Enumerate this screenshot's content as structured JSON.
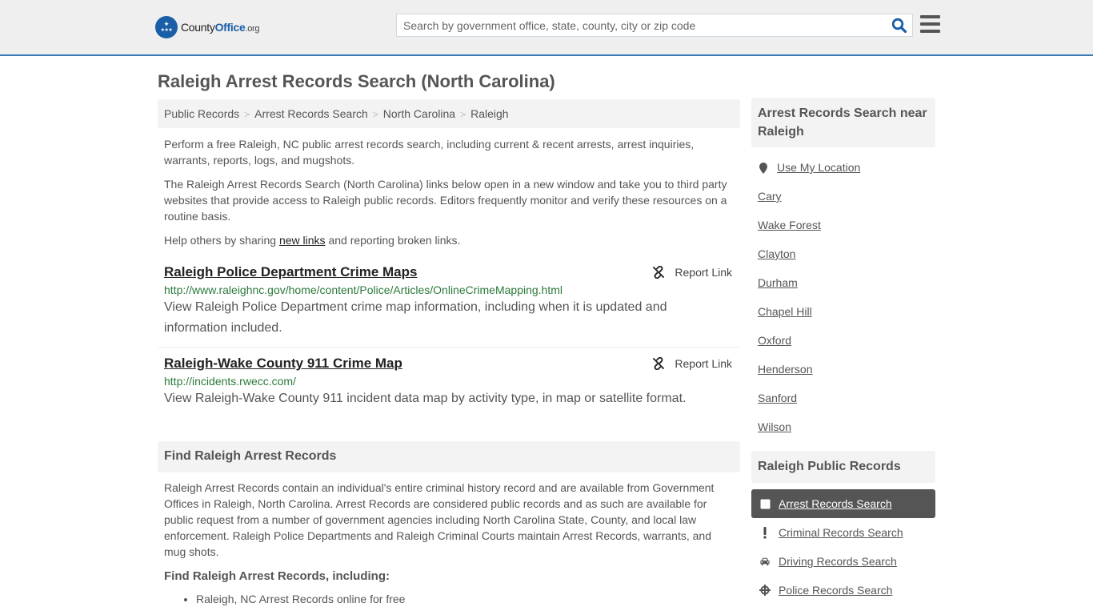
{
  "header": {
    "logo": {
      "name_part1": "County",
      "name_part2": "Office",
      "tld": ".org"
    },
    "search": {
      "placeholder": "Search by government office, state, county, city or zip code",
      "value": ""
    },
    "icons": {
      "search": "search-icon",
      "menu": "hamburger-menu-icon"
    }
  },
  "page": {
    "title": "Raleigh Arrest Records Search (North Carolina)"
  },
  "breadcrumb": [
    {
      "label": "Public Records"
    },
    {
      "label": "Arrest Records Search"
    },
    {
      "label": "North Carolina"
    },
    {
      "label": "Raleigh"
    }
  ],
  "intro": {
    "p1": "Perform a free Raleigh, NC public arrest records search, including current & recent arrests, arrest inquiries, warrants, reports, logs, and mugshots.",
    "p2": "The Raleigh Arrest Records Search (North Carolina) links below open in a new window and take you to third party websites that provide access to Raleigh public records. Editors frequently monitor and verify these resources on a routine basis.",
    "p3_before": "Help others by sharing ",
    "p3_link": "new links",
    "p3_after": " and reporting broken links."
  },
  "links": [
    {
      "title": "Raleigh Police Department Crime Maps",
      "url": "http://www.raleighnc.gov/home/content/Police/Articles/OnlineCrimeMapping.html",
      "description": "View Raleigh Police Department crime map information, including when it is updated and information included.",
      "report_label": "Report Link"
    },
    {
      "title": "Raleigh-Wake County 911 Crime Map",
      "url": "http://incidents.rwecc.com/",
      "description": "View Raleigh-Wake County 911 incident data map by activity type, in map or satellite format.",
      "report_label": "Report Link"
    }
  ],
  "find_section": {
    "heading": "Find Raleigh Arrest Records",
    "body": "Raleigh Arrest Records contain an individual's entire criminal history record and are available from Government Offices in Raleigh, North Carolina. Arrest Records are considered public records and as such are available for public request from a number of government agencies including North Carolina State, County, and local law enforcement. Raleigh Police Departments and Raleigh Criminal Courts maintain Arrest Records, warrants, and mug shots.",
    "subheading": "Find Raleigh Arrest Records, including:",
    "bullets": [
      "Raleigh, NC Arrest Records online for free"
    ]
  },
  "sidebar": {
    "near_heading": "Arrest Records Search near Raleigh",
    "use_location": "Use My Location",
    "near_cities": [
      "Cary",
      "Wake Forest",
      "Clayton",
      "Durham",
      "Chapel Hill",
      "Oxford",
      "Henderson",
      "Sanford",
      "Wilson"
    ],
    "public_heading": "Raleigh Public Records",
    "public_records": [
      {
        "label": "Arrest Records Search",
        "icon": "square-icon",
        "active": true
      },
      {
        "label": "Criminal Records Search",
        "icon": "exclamation-icon",
        "active": false
      },
      {
        "label": "Driving Records Search",
        "icon": "car-icon",
        "active": false
      },
      {
        "label": "Police Records Search",
        "icon": "crosshair-icon",
        "active": false
      }
    ]
  },
  "colors": {
    "brand_blue": "#1a5ea8",
    "header_border": "#3b7bb5",
    "url_green": "#2b7a3b",
    "active_item_bg": "#555555"
  }
}
